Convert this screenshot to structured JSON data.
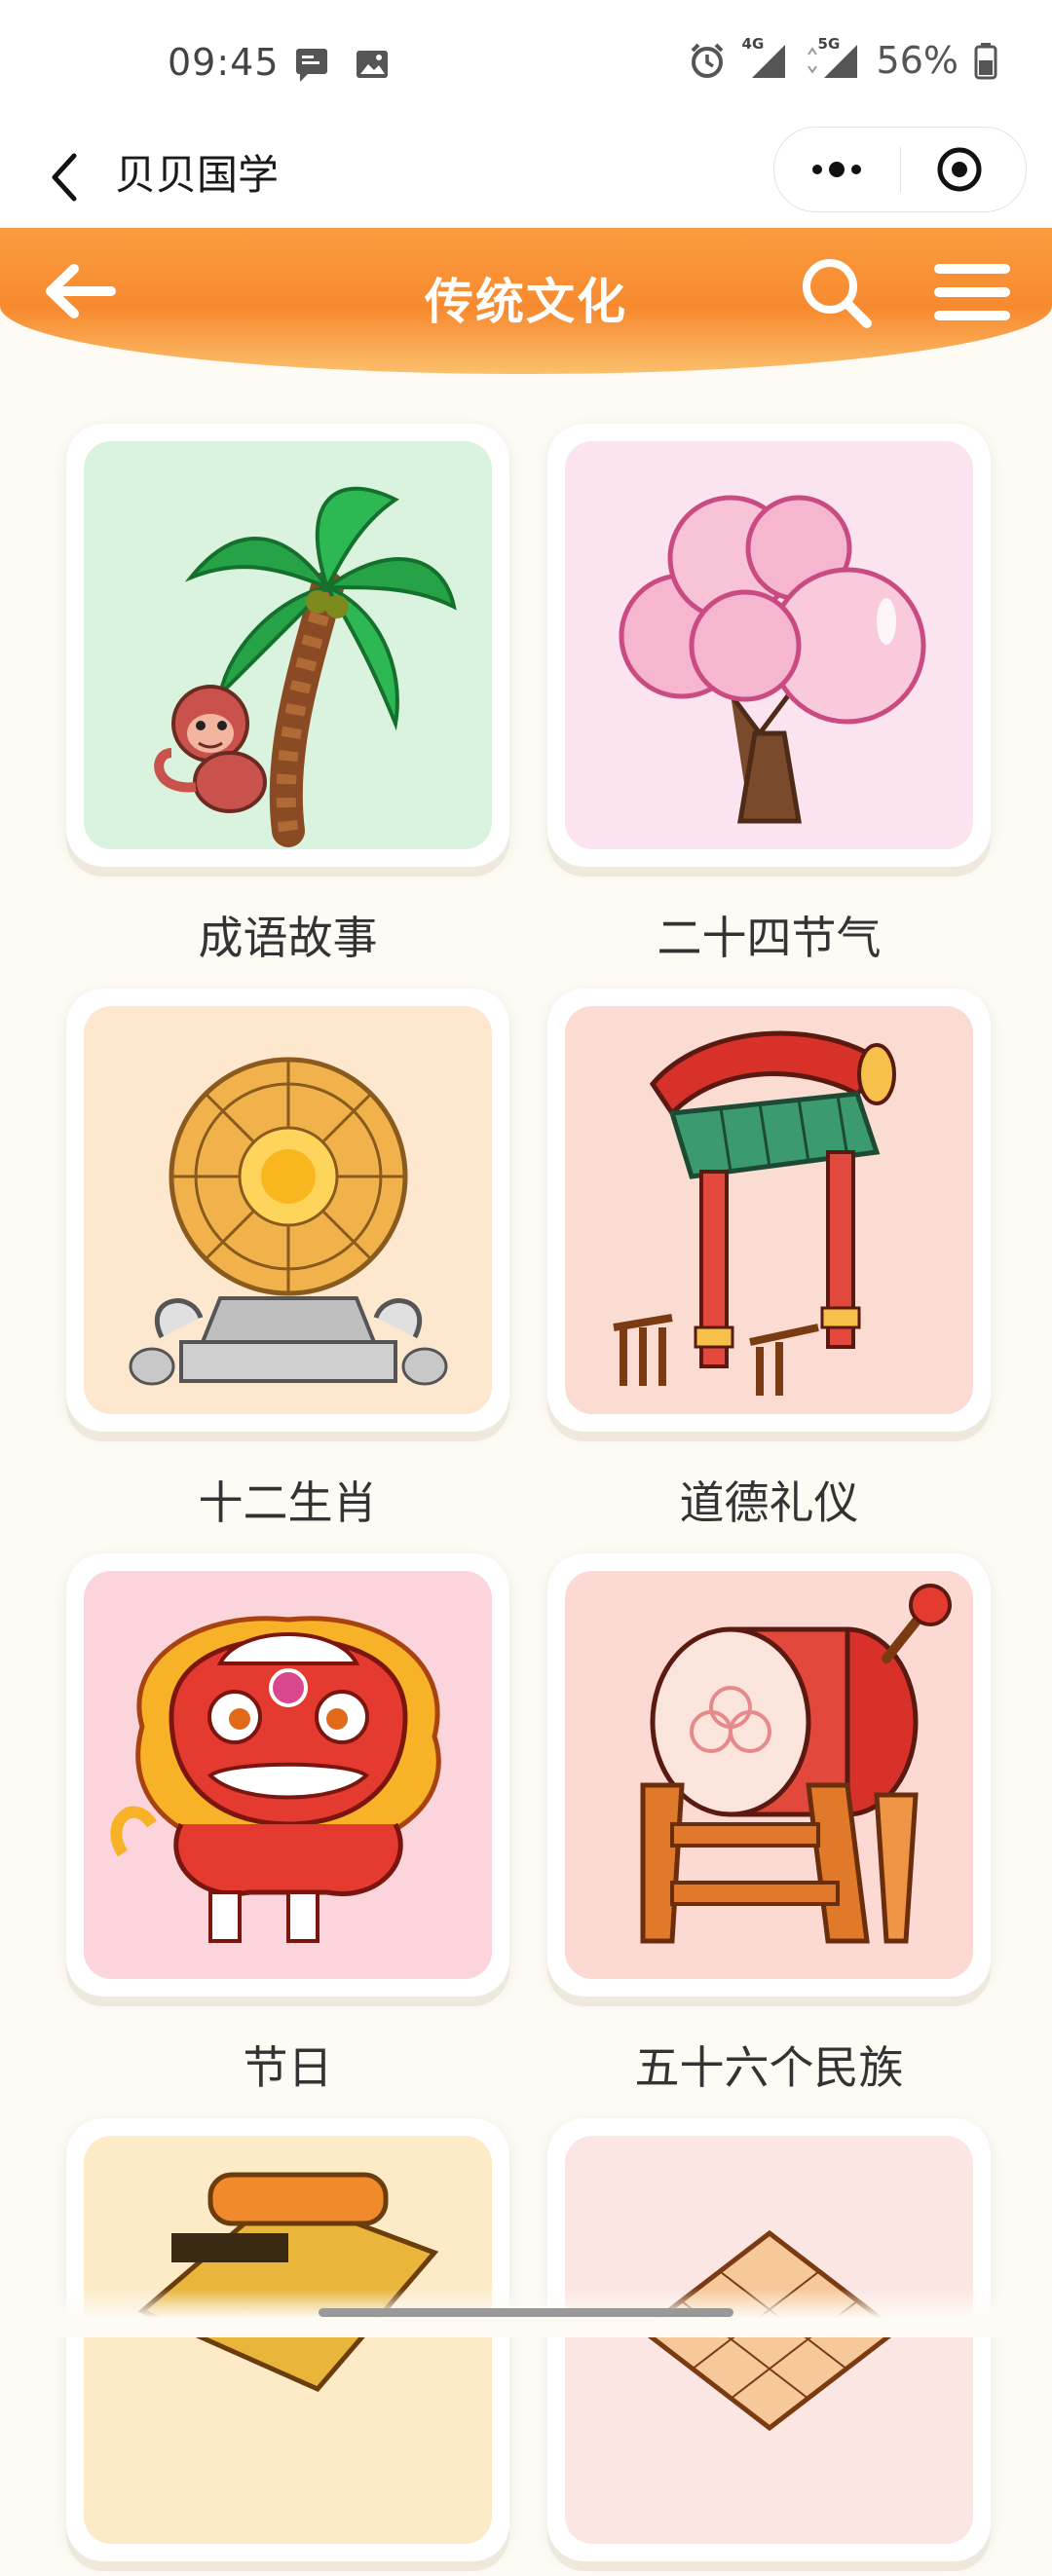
{
  "status": {
    "time": "09:45",
    "network_1": "4G",
    "network_2": "5G",
    "battery": "56%"
  },
  "nav": {
    "back_icon": "chevron-left-icon",
    "title": "贝贝国学",
    "more_icon": "more-dots-icon",
    "close_icon": "target-close-icon"
  },
  "header": {
    "title": "传统文化",
    "back_icon": "arrow-left-icon",
    "search_icon": "search-icon",
    "menu_icon": "menu-icon",
    "color": "#f78a2f"
  },
  "categories": [
    {
      "label": "成语故事",
      "bg": "#d9f3de",
      "icon": "palm-tree-monkey-icon"
    },
    {
      "label": "二十四节气",
      "bg": "#fbe3ef",
      "icon": "cherry-blossom-tree-icon"
    },
    {
      "label": "十二生肖",
      "bg": "#fde8cf",
      "icon": "zodiac-wheel-icon"
    },
    {
      "label": "道德礼仪",
      "bg": "#fbdcd3",
      "icon": "temple-gate-icon"
    },
    {
      "label": "节日",
      "bg": "#fcd5dc",
      "icon": "lion-dance-icon"
    },
    {
      "label": "五十六个民族",
      "bg": "#fcd9d2",
      "icon": "drum-icon"
    },
    {
      "label": "",
      "bg": "#fdebc8",
      "icon": "scroll-book-icon"
    },
    {
      "label": "",
      "bg": "#fce6e4",
      "icon": "go-board-icon"
    }
  ]
}
